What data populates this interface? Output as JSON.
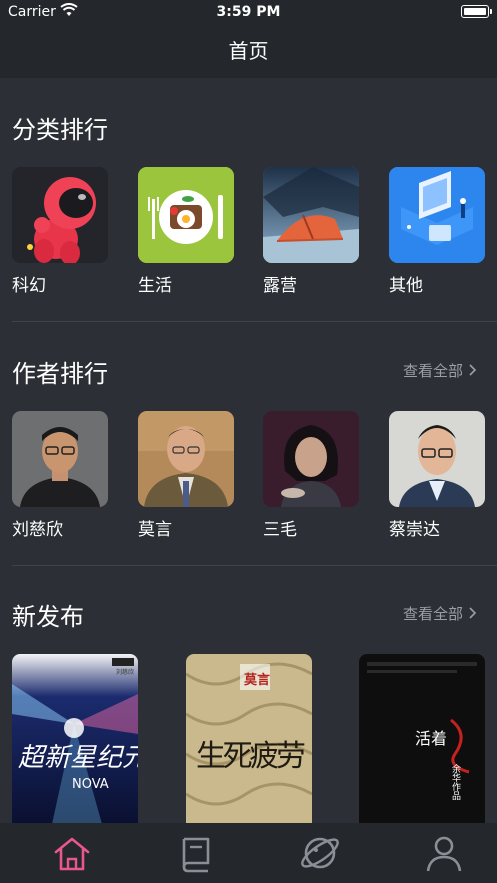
{
  "status": {
    "carrier": "Carrier",
    "time": "3:59 PM"
  },
  "nav": {
    "title": "首页"
  },
  "categories": {
    "title": "分类排行",
    "items": [
      {
        "label": "科幻",
        "icon": "astronaut-icon"
      },
      {
        "label": "生活",
        "icon": "breakfast-plate-icon"
      },
      {
        "label": "露营",
        "icon": "tent-icon"
      },
      {
        "label": "其他",
        "icon": "isometric-office-icon"
      }
    ]
  },
  "authors": {
    "title": "作者排行",
    "see_all": "查看全部",
    "items": [
      {
        "name": "刘慈欣"
      },
      {
        "name": "莫言"
      },
      {
        "name": "三毛"
      },
      {
        "name": "蔡崇达"
      }
    ]
  },
  "new_releases": {
    "title": "新发布",
    "see_all": "查看全部",
    "books": [
      {
        "cover_text": "超新星纪元",
        "cover_sub": "NOVA",
        "author": "刘慈欣"
      },
      {
        "cover_text": "生死疲劳",
        "author": "莫言"
      },
      {
        "cover_text": "活着",
        "author": "余华作品"
      }
    ]
  },
  "tabbar": {
    "active": "home",
    "tabs": [
      "home",
      "library",
      "discover",
      "profile"
    ]
  },
  "colors": {
    "accent": "#e9578d",
    "bg": "#2c3036",
    "bar": "#24272c",
    "muted": "#9a9ea5"
  }
}
